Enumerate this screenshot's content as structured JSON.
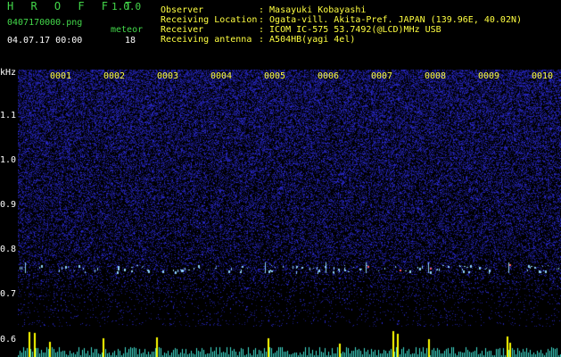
{
  "app": {
    "title": "H R O F F T",
    "version": "1.0.0"
  },
  "file": {
    "name": "0407170000.png",
    "datetime": "04.07.17 00:00"
  },
  "meteor": {
    "label": "meteor",
    "count": "18"
  },
  "info": {
    "observer_label": "Observer",
    "observer_value": ": Masayuki Kobayashi",
    "location_label": "Receiving Location",
    "location_value": ": Ogata-vill. Akita-Pref. JAPAN (139.96E, 40.02N)",
    "receiver_label": "Receiver",
    "receiver_value": ": ICOM IC-575 53.7492(@LCD)MHz USB",
    "antenna_label": "Receiving antenna",
    "antenna_value": ": A504HB(yagi 4el)"
  },
  "spectrogram": {
    "y_unit": "kHz",
    "y_ticks": [
      "1.1",
      "1.0",
      "0.9",
      "0.8",
      "0.7"
    ],
    "bottom_tick": "0.6",
    "time_labels": [
      "0001",
      "0002",
      "0003",
      "0004",
      "0005",
      "0006",
      "0007",
      "0008",
      "0009",
      "0010"
    ],
    "colors": {
      "noise": "#2a2ad8",
      "signal": "#8fd0ff",
      "hot": "#ff6060",
      "label": "#ffff40",
      "bar_cyan": "#40e0d0",
      "bar_yellow": "#ffff00"
    }
  }
}
